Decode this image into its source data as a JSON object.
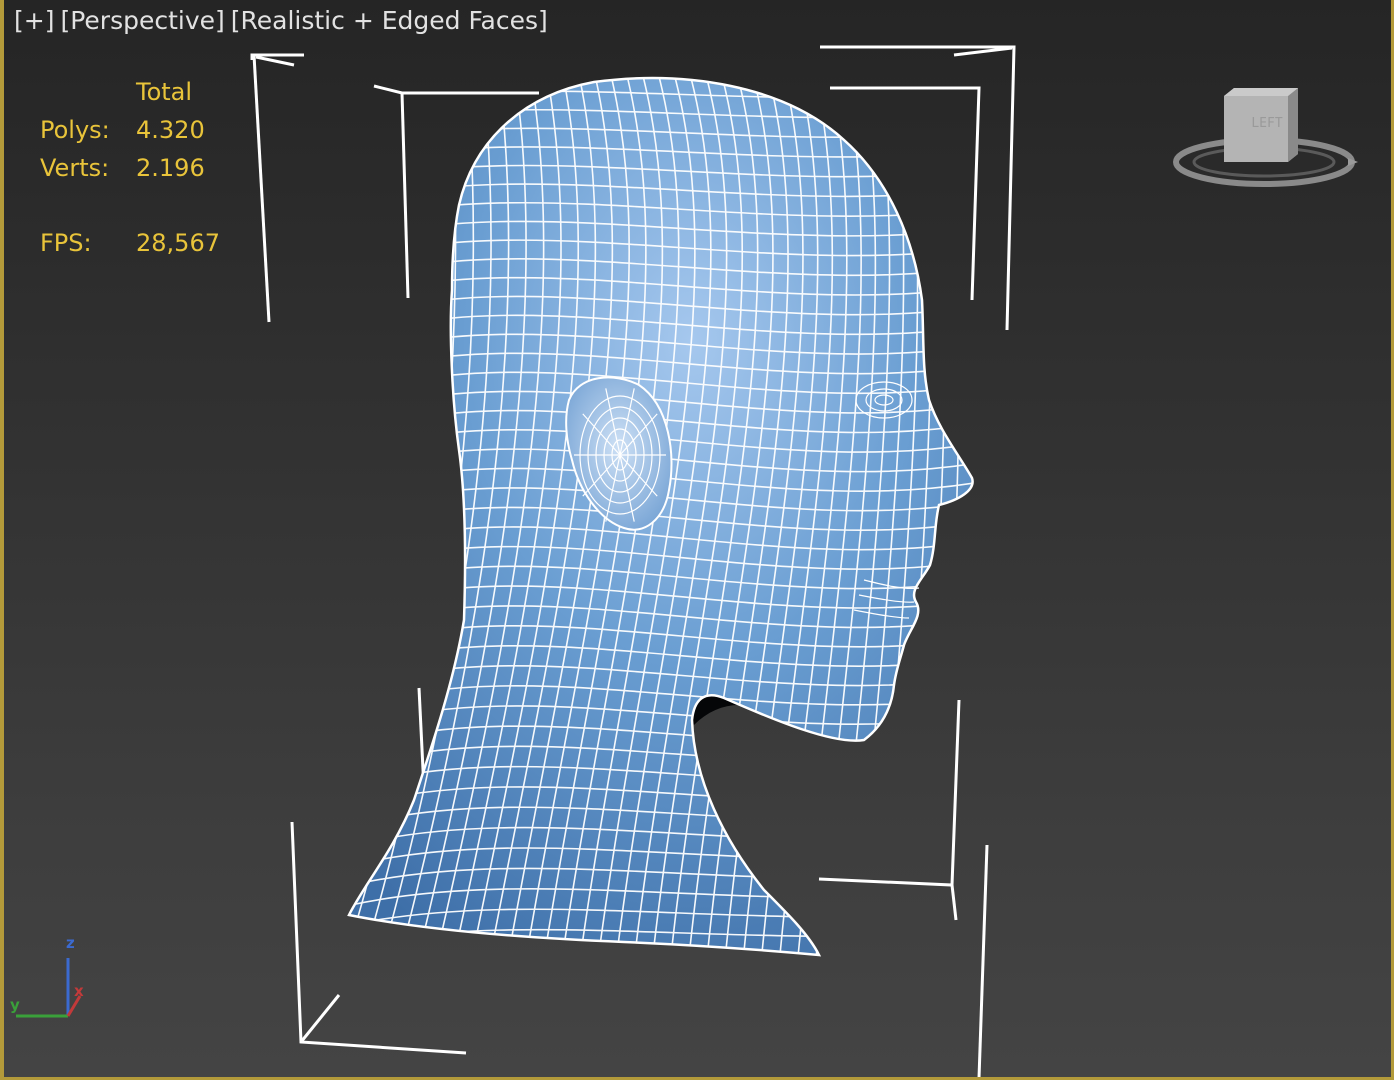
{
  "viewport": {
    "label_plus": "[+]",
    "label_view": "[Perspective]",
    "label_shading": "[Realistic + Edged Faces]",
    "border_color": "#b39a3a"
  },
  "statistics": {
    "column_header": "Total",
    "polys_label": "Polys:",
    "polys_value": "4.320",
    "verts_label": "Verts:",
    "verts_value": "2.196",
    "fps_label": "FPS:",
    "fps_value": "28,567",
    "text_color": "#e9c43a"
  },
  "viewcube": {
    "face_label": "LEFT"
  },
  "axis_tripod": {
    "z_label": "z",
    "x_label": "x",
    "y_label": "y",
    "z_color": "#3b6ad0",
    "x_color": "#c23a3a",
    "y_color": "#3aa03a"
  },
  "model": {
    "name_icon": "head-mesh",
    "surface_color": "#5f93c9",
    "wire_color": "#ffffff",
    "bounding_box_color": "#ffffff"
  }
}
